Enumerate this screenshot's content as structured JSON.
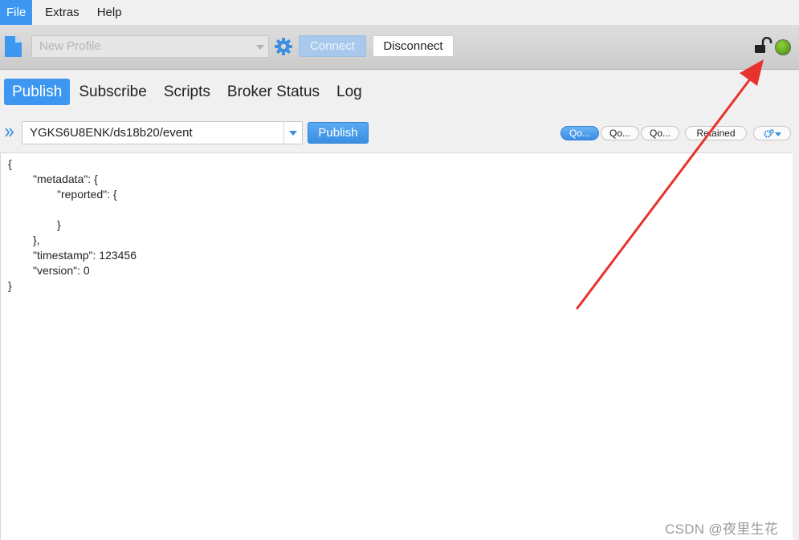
{
  "menu": {
    "file": "File",
    "extras": "Extras",
    "help": "Help"
  },
  "toolbar": {
    "profile_placeholder": "New Profile",
    "connect_label": "Connect",
    "disconnect_label": "Disconnect",
    "status_color": "#6cb422"
  },
  "tabs": [
    {
      "label": "Publish",
      "active": true
    },
    {
      "label": "Subscribe",
      "active": false
    },
    {
      "label": "Scripts",
      "active": false
    },
    {
      "label": "Broker Status",
      "active": false
    },
    {
      "label": "Log",
      "active": false
    }
  ],
  "publish": {
    "topic": "YGKS6U8ENK/ds18b20/event",
    "publish_label": "Publish",
    "qos0": "Qo...",
    "qos1": "Qo...",
    "qos2": "Qo...",
    "retained": "Retained"
  },
  "payload": {
    "lines": [
      "{",
      "\t\"metadata\": {",
      "\t\t\"reported\": {",
      "",
      "\t\t}",
      "\t},",
      "\t\"timestamp\": 123456",
      "\t\"version\": 0",
      "}"
    ]
  },
  "watermark": "CSDN @夜里生花",
  "colors": {
    "accent": "#3d97f0",
    "annotation_arrow": "#e8322d"
  },
  "icons": [
    "new-profile-doc-icon",
    "settings-gear-icon",
    "unlocked-padlock-icon",
    "expand-chevron-icon",
    "publish-options-gear-icon"
  ]
}
